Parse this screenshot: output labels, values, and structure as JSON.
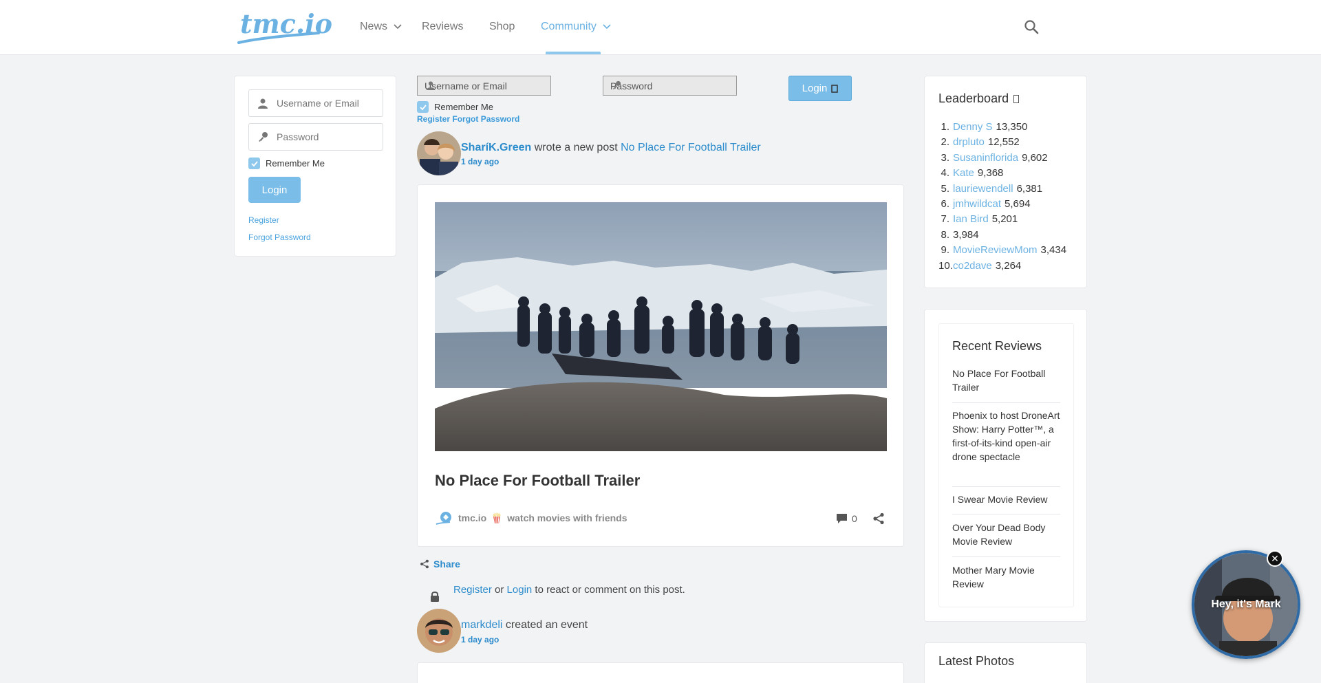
{
  "header": {
    "logo_text": "tmc.io",
    "nav": [
      {
        "label": "News",
        "dropdown": true
      },
      {
        "label": "Reviews",
        "dropdown": false
      },
      {
        "label": "Shop",
        "dropdown": false
      },
      {
        "label": "Community",
        "dropdown": true,
        "active": true
      }
    ]
  },
  "left_login": {
    "username_placeholder": "Username or Email",
    "password_placeholder": "Password",
    "remember_label": "Remember Me",
    "remember_checked": true,
    "login_label": "Login",
    "register_label": "Register",
    "forgot_label": "Forgot Password"
  },
  "top_login": {
    "username_placeholder": "Username or Email",
    "password_placeholder": "Password",
    "remember_label": "Remember Me",
    "login_label": "Login",
    "register_label": "Register",
    "forgot_label": "Forgot Password"
  },
  "activity1": {
    "user": "SharíK.Green",
    "action": "wrote a new post",
    "post_link": "No Place For Football Trailer",
    "time": "1 day ago"
  },
  "post": {
    "title": "No Place For Football Trailer",
    "source": "tmc.io",
    "tagline": "watch movies with friends",
    "comments": "0"
  },
  "share": {
    "label": "Share"
  },
  "register_prompt": {
    "register": "Register",
    "or": "or",
    "login": "Login",
    "rest": "to react or comment on this post."
  },
  "activity2": {
    "user": "markdeli",
    "action": "created an event",
    "time": "1 day ago"
  },
  "leaderboard": {
    "title": "Leaderboard",
    "entries": [
      {
        "rank": "1.",
        "name": "Denny S",
        "score": "13,350"
      },
      {
        "rank": "2.",
        "name": "drpluto",
        "score": "12,552"
      },
      {
        "rank": "3.",
        "name": "Susaninflorida",
        "score": "9,602"
      },
      {
        "rank": "4.",
        "name": "Kate",
        "score": "9,368"
      },
      {
        "rank": "5.",
        "name": "lauriewendell",
        "score": "6,381"
      },
      {
        "rank": "6.",
        "name": "jmhwildcat",
        "score": "5,694"
      },
      {
        "rank": "7.",
        "name": "Ian Bird",
        "score": "5,201"
      },
      {
        "rank": "8.",
        "name": "",
        "score": "3,984"
      },
      {
        "rank": "9.",
        "name": "MovieReviewMom",
        "score": "3,434"
      },
      {
        "rank": "10.",
        "name": "co2dave",
        "score": "3,264"
      }
    ]
  },
  "recent_reviews": {
    "title": "Recent Reviews",
    "items": [
      "No Place For Football Trailer",
      "Phoenix to host DroneArt Show: Harry Potter™, a first-of-its-kind open-air drone spectacle",
      "I Swear Movie Review",
      "Over Your Dead Body Movie Review",
      "Mother Mary Movie Review"
    ]
  },
  "latest_photos": {
    "title": "Latest Photos"
  },
  "video": {
    "text": "Hey, it's Mark"
  },
  "colors": {
    "accent": "#6bb2e3",
    "link": "#2d8ccc",
    "button": "#79bde8"
  }
}
